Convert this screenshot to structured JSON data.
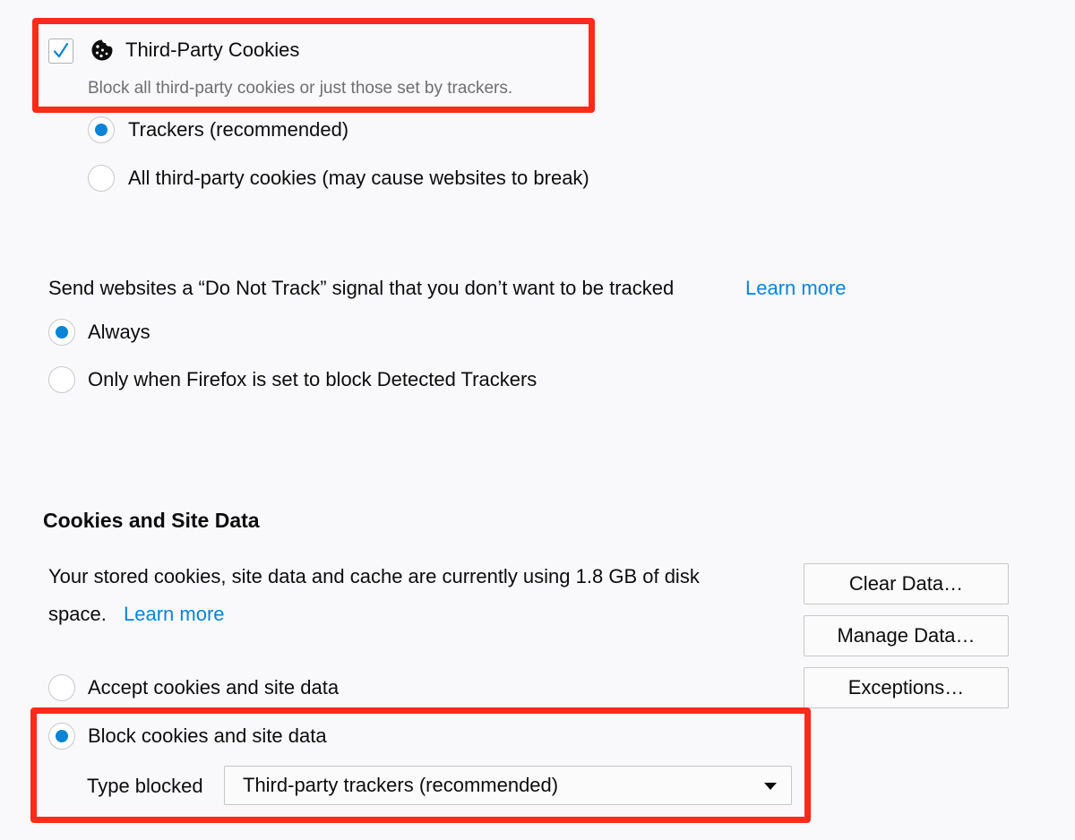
{
  "third_party": {
    "checked": true,
    "label": "Third-Party Cookies",
    "description": "Block all third-party cookies or just those set by trackers.",
    "options": [
      {
        "label": "Trackers (recommended)",
        "selected": true
      },
      {
        "label": "All third-party cookies (may cause websites to break)",
        "selected": false
      }
    ]
  },
  "dnt": {
    "prompt": "Send websites a “Do Not Track” signal that you don’t want to be tracked",
    "learn_more": "Learn more",
    "options": [
      {
        "label": "Always",
        "selected": true
      },
      {
        "label": "Only when Firefox is set to block Detected Trackers",
        "selected": false
      }
    ]
  },
  "cookies_site_data": {
    "title": "Cookies and Site Data",
    "usage_line1": "Your stored cookies, site data and cache are currently using 1.8 GB of disk",
    "usage_line2": "space.",
    "learn_more": "Learn more",
    "buttons": {
      "clear": "Clear Data…",
      "manage": "Manage Data…",
      "exceptions": "Exceptions…"
    },
    "options": [
      {
        "label": "Accept cookies and site data",
        "selected": false
      },
      {
        "label": "Block cookies and site data",
        "selected": true
      }
    ],
    "type_blocked_label": "Type blocked",
    "type_blocked_value": "Third-party trackers (recommended)"
  },
  "colors": {
    "accent": "#0a84d6",
    "highlight": "#ff2a1a"
  },
  "icons": [
    "checkmark-icon",
    "cookie-icon",
    "dropdown-arrow-icon"
  ]
}
